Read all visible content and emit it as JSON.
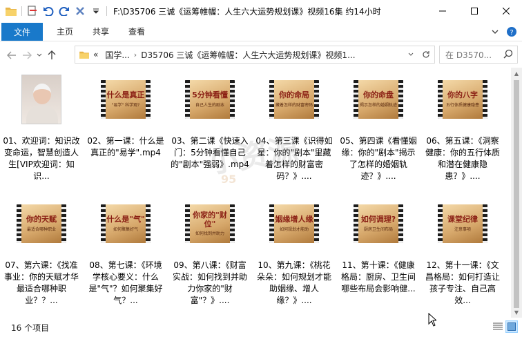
{
  "window": {
    "title": "F:\\D35706 三诚《运筹帷幄：人生六大运势规划课》视频16集 约14小时"
  },
  "ribbon": {
    "file_tab": "文件",
    "tabs": [
      "主页",
      "共享",
      "查看"
    ]
  },
  "address": {
    "overflow": "«",
    "crumbs": [
      "国学...",
      "D35706 三诚《运筹帷幄：人生六大运势规划课》视频1..."
    ],
    "search_placeholder": "在 D3570..."
  },
  "items": [
    {
      "caption": "01、欢迎词：知识改变命运，智慧创造人生[VIP欢迎词：知识...",
      "thumb": "portrait",
      "frame_title": "",
      "frame_sub": ""
    },
    {
      "caption": "02、第一课：什么是真正的\"易学\".mp4",
      "thumb": "film",
      "frame_title": "什么是真正",
      "frame_sub": "\"易学\" 科学观?"
    },
    {
      "caption": "03、第二课《快速入门：5分钟看懂自己的\"剧本\"强弱》.mp4",
      "thumb": "film",
      "frame_title": "5分钟看懂",
      "frame_sub": "自己人生的剧本"
    },
    {
      "caption": "04、第三课《识得如星：你的\"剧本\"里藏着怎样的财富密码？》....",
      "thumb": "film",
      "frame_title": "你的命局",
      "frame_sub": "藏着怎样的财富密码"
    },
    {
      "caption": "05、第四课《看懂姻缘：你的\"剧本\"揭示了怎样的婚姻轨迹？》....",
      "thumb": "film",
      "frame_title": "你的命盘",
      "frame_sub": "揭示怎样的婚姻轨迹"
    },
    {
      "caption": "06、第五课：《洞察健康：你的五行体质和潜在健康隐患？》....",
      "thumb": "film",
      "frame_title": "你的八字",
      "frame_sub": "五行体质健康隐患"
    },
    {
      "caption": "07、第六课：《找准事业：你的天赋才华最适合哪种职业？？...",
      "thumb": "film",
      "frame_title": "你的天赋",
      "frame_sub": "最适合哪种职业"
    },
    {
      "caption": "08、第七课：《环境学核心要义：什么是\"气\"？如何聚集好气？...",
      "thumb": "film",
      "frame_title": "什么是\"气\"",
      "frame_sub": "如何聚集好气"
    },
    {
      "caption": "09、第八课：《财富实战：如何找到并助力你家的\"财富\"？》....",
      "thumb": "film",
      "frame_title": "你家的\"财位\"",
      "frame_sub": "如何找到并助力"
    },
    {
      "caption": "10、第九课：《桃花朵朵：如何规划才能助姻缘、增人缘？》....",
      "thumb": "film",
      "frame_title": "姻缘增人缘",
      "frame_sub": "如何规划才能助"
    },
    {
      "caption": "11、第十课：《健康格局：厨房、卫生间哪些布局会影响健...",
      "thumb": "film",
      "frame_title": "如何调理?",
      "frame_sub": "厨房卫生间布局"
    },
    {
      "caption": "12、第十一课：《文昌格局：如何打造让孩子专注、自己高效...",
      "thumb": "film",
      "frame_title": "课堂纪律",
      "frame_sub": "注意事项"
    }
  ],
  "status": {
    "count": "16 个项目"
  },
  "watermark": {
    "main": "小资源",
    "sub": "95"
  }
}
